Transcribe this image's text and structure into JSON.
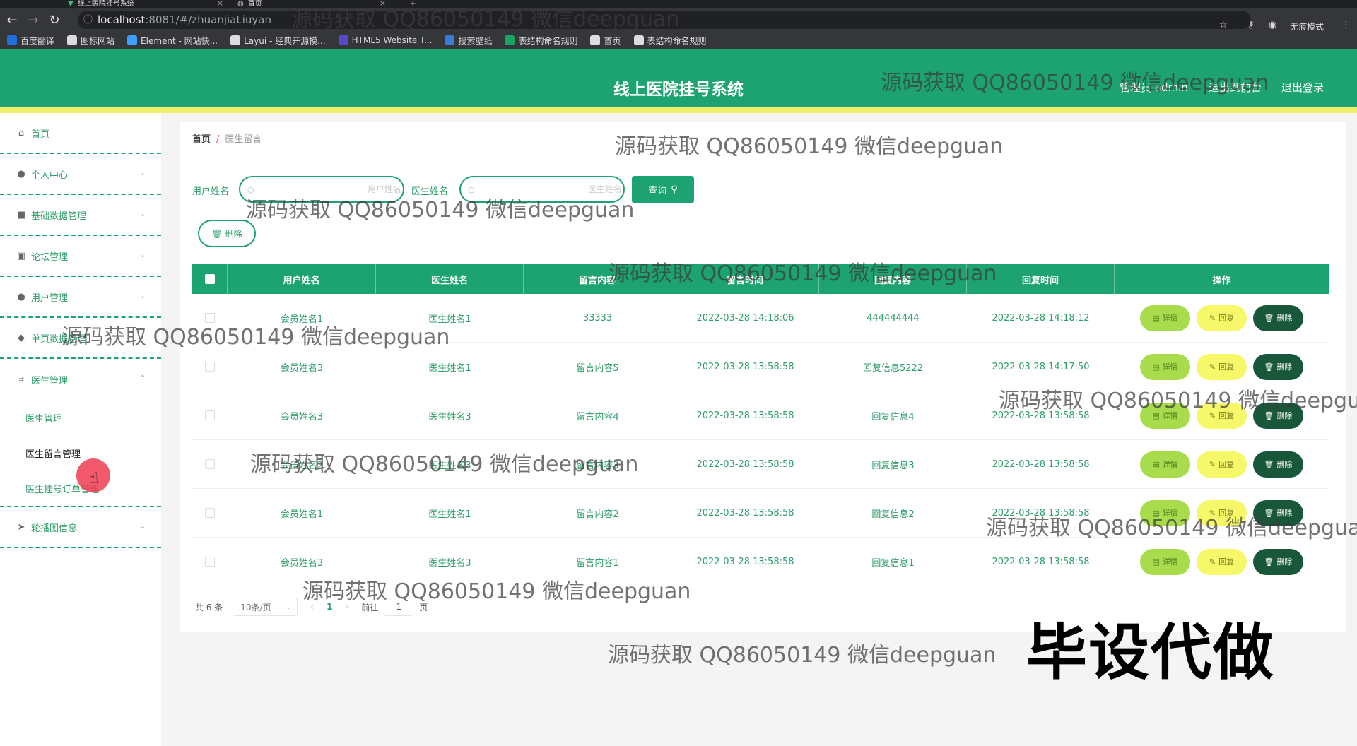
{
  "browser": {
    "tabs": [
      {
        "title": "线上医院挂号系统"
      },
      {
        "title": "首页"
      }
    ],
    "url_host": "localhost",
    "url_path": ":8081/#/zhuanjiaLiuyan",
    "incognito_label": "无痕模式",
    "bookmarks": [
      {
        "label": "百度翻译",
        "color": "#1e6fd9"
      },
      {
        "label": "图标网站",
        "color": "#dddddd"
      },
      {
        "label": "Element - 网站快...",
        "color": "#409eff"
      },
      {
        "label": "Layui - 经典开源模...",
        "color": "#dddddd"
      },
      {
        "label": "HTML5 Website T...",
        "color": "#5b48c9"
      },
      {
        "label": "搜索壁纸",
        "color": "#3b7bd5"
      },
      {
        "label": "表结构命名规则",
        "color": "#1aa260"
      },
      {
        "label": "首页",
        "color": "#dddddd"
      },
      {
        "label": "表结构命名规则",
        "color": "#dddddd"
      }
    ]
  },
  "header": {
    "title": "线上医院挂号系统",
    "admin": "管理员 admin",
    "back_front": "退出到前台",
    "logout": "退出登录",
    "color": "#1ca371",
    "accent": "#f1f06b"
  },
  "sidebar": {
    "items": [
      {
        "label": "首页",
        "icon": "home-icon"
      },
      {
        "label": "个人中心",
        "icon": "user-icon"
      },
      {
        "label": "基础数据管理",
        "icon": "video-icon"
      },
      {
        "label": "论坛管理",
        "icon": "clipboard-icon"
      },
      {
        "label": "用户管理",
        "icon": "user-icon"
      },
      {
        "label": "单页数据管理",
        "icon": "location-icon"
      },
      {
        "label": "医生管理",
        "icon": "crop-icon"
      }
    ],
    "sub_items": [
      {
        "label": "医生管理"
      },
      {
        "label": "医生留言管理"
      },
      {
        "label": "医生挂号订单管理"
      }
    ],
    "last_item": {
      "label": "轮播图信息",
      "icon": "send-icon"
    }
  },
  "breadcrumb": {
    "home": "首页",
    "separator": "/",
    "current": "医生留言"
  },
  "search": {
    "user_label": "用户姓名",
    "user_placeholder": "用户姓名",
    "doctor_label": "医生姓名",
    "doctor_placeholder": "医生姓名",
    "query_button": "查询",
    "delete_button": "删除"
  },
  "table": {
    "headers": [
      "用户姓名",
      "医生姓名",
      "留言内容",
      "留言时间",
      "回复内容",
      "回复时间",
      "操作"
    ],
    "rows": [
      {
        "user": "会员姓名1",
        "doctor": "医生姓名1",
        "content": "33333",
        "time": "2022-03-28 14:18:06",
        "reply": "444444444",
        "reply_time": "2022-03-28 14:18:12"
      },
      {
        "user": "会员姓名3",
        "doctor": "医生姓名1",
        "content": "留言内容5",
        "time": "2022-03-28 13:58:58",
        "reply": "回复信息5222",
        "reply_time": "2022-03-28 14:17:50"
      },
      {
        "user": "会员姓名3",
        "doctor": "医生姓名3",
        "content": "留言内容4",
        "time": "2022-03-28 13:58:58",
        "reply": "回复信息4",
        "reply_time": "2022-03-28 13:58:58"
      },
      {
        "user": "会员姓名2",
        "doctor": "医生姓名3",
        "content": "留言内容3",
        "time": "2022-03-28 13:58:58",
        "reply": "回复信息3",
        "reply_time": "2022-03-28 13:58:58"
      },
      {
        "user": "会员姓名1",
        "doctor": "医生姓名1",
        "content": "留言内容2",
        "time": "2022-03-28 13:58:58",
        "reply": "回复信息2",
        "reply_time": "2022-03-28 13:58:58"
      },
      {
        "user": "会员姓名3",
        "doctor": "医生姓名3",
        "content": "留言内容1",
        "time": "2022-03-28 13:58:58",
        "reply": "回复信息1",
        "reply_time": "2022-03-28 13:58:58"
      }
    ],
    "actions": {
      "detail": "详情",
      "reply": "回复",
      "delete": "删除"
    }
  },
  "pagination": {
    "total": "共 6 条",
    "page_size": "10条/页",
    "current_page": "1",
    "goto_label": "前往",
    "goto_value": "1",
    "page_suffix": "页"
  },
  "watermarks": {
    "text": "源码获取 QQ86050149 微信deepguan",
    "big_text": "毕设代做"
  }
}
